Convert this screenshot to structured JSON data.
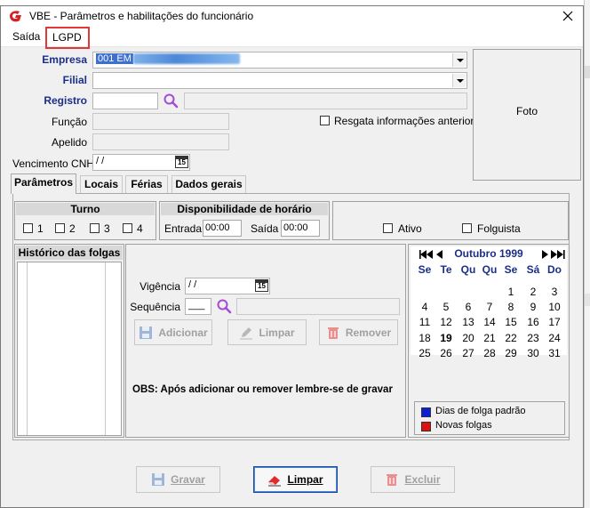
{
  "window": {
    "title": "VBE - Parâmetros e habilitações do funcionário"
  },
  "menu": {
    "items": [
      {
        "label": "Saída"
      },
      {
        "label": "LGPD"
      }
    ]
  },
  "form": {
    "empresa_label": "Empresa",
    "empresa_value": "001 EM",
    "filial_label": "Filial",
    "filial_value": "",
    "registro_label": "Registro",
    "registro_value": "",
    "funcao_label": "Função",
    "apelido_label": "Apelido",
    "venc_cnh_label": "Vencimento CNH",
    "venc_cnh_value": " / /",
    "resgata_label": "Resgata informações anteriores",
    "foto_label": "Foto",
    "calendar_button_glyph": "15"
  },
  "tabs": [
    {
      "label": "Parâmetros"
    },
    {
      "label": "Locais"
    },
    {
      "label": "Férias"
    },
    {
      "label": "Dados gerais"
    }
  ],
  "turno": {
    "title": "Turno",
    "options": [
      {
        "label": "1"
      },
      {
        "label": "2"
      },
      {
        "label": "3"
      },
      {
        "label": "4"
      }
    ]
  },
  "disponibilidade": {
    "title": "Disponibilidade de horário",
    "entrada_label": "Entrada",
    "entrada_value": "00:00",
    "saida_label": "Saída",
    "saida_value": "00:00"
  },
  "status": {
    "ativo_label": "Ativo",
    "folguista_label": "Folguista"
  },
  "historico": {
    "title": "Histórico das folgas"
  },
  "folga_form": {
    "vigencia_label": "Vigência",
    "vigencia_value": " / /",
    "sequencia_label": "Sequência",
    "sequencia_value": "___",
    "adicionar_label": "Adicionar",
    "limpar_label": "Limpar",
    "remover_label": "Remover",
    "obs_text": "OBS: Após adicionar ou remover lembre-se de gravar"
  },
  "calendar": {
    "month_label": "Outubro 1999",
    "weekdays": [
      "Se",
      "Te",
      "Qu",
      "Qu",
      "Se",
      "Sá",
      "Do"
    ],
    "weeks": [
      [
        "",
        "",
        "",
        "",
        "1",
        "2",
        "3"
      ],
      [
        "4",
        "5",
        "6",
        "7",
        "8",
        "9",
        "10"
      ],
      [
        "11",
        "12",
        "13",
        "14",
        "15",
        "16",
        "17"
      ],
      [
        "18",
        "19",
        "20",
        "21",
        "22",
        "23",
        "24"
      ],
      [
        "25",
        "26",
        "27",
        "28",
        "29",
        "30",
        "31"
      ]
    ],
    "today": "19",
    "legend": [
      {
        "label": "Dias de folga padrão",
        "color": "#0a1fd6"
      },
      {
        "label": "Novas folgas",
        "color": "#e01010"
      }
    ]
  },
  "footer": {
    "gravar_label": "Gravar",
    "limpar_label": "Limpar",
    "excluir_label": "Excluir"
  },
  "colors": {
    "label_blue": "#1a2e8a",
    "highlight_red": "#e23737",
    "icon_purple": "#a24bd6",
    "remove_red": "#e02020",
    "save_blue": "#2a5fb0"
  }
}
